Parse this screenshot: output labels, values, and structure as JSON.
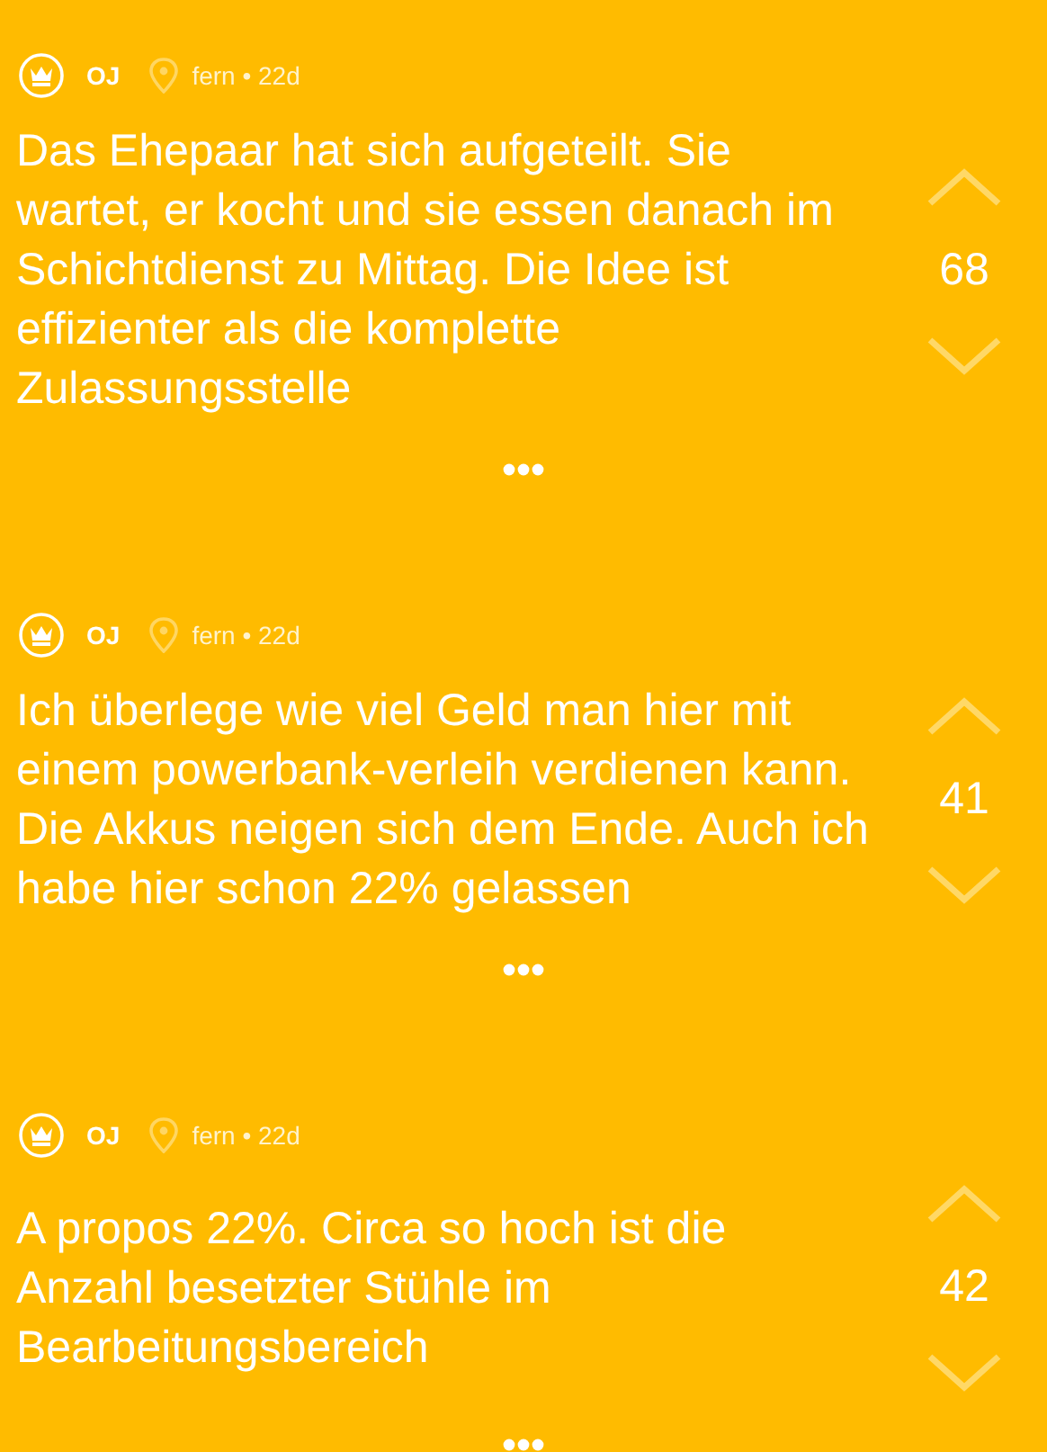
{
  "posts": [
    {
      "author": "OJ",
      "meta": "fern • 22d",
      "text": "Das Ehepaar hat sich aufgeteilt. Sie wartet, er kocht und sie essen danach im Schichtdienst zu Mittag. Die Idee ist effizienter als die komplette Zulassungsstelle",
      "votes": "68"
    },
    {
      "author": "OJ",
      "meta": "fern • 22d",
      "text": "Ich überlege wie viel Geld man hier mit einem powerbank-verleih verdienen kann. Die Akkus neigen sich dem Ende. Auch ich habe hier schon 22% gelassen",
      "votes": "41"
    },
    {
      "author": "OJ",
      "meta": "fern • 22d",
      "text": "A propos 22%. Circa so hoch ist die Anzahl besetzter Stühle im Bearbeitungsbereich",
      "votes": "42"
    }
  ]
}
